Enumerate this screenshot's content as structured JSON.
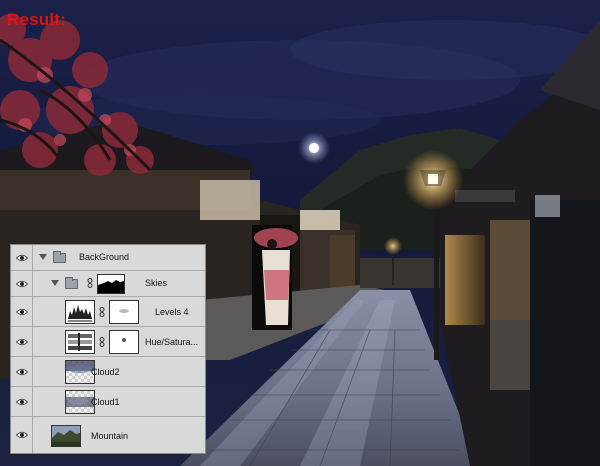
{
  "result_label": "Result:",
  "layers_panel": {
    "layers": [
      {
        "name": "BackGround",
        "type": "group"
      },
      {
        "name": "Skies",
        "type": "group"
      },
      {
        "name": "Levels 4",
        "type": "adjustment"
      },
      {
        "name": "Hue/Satura...",
        "type": "adjustment"
      },
      {
        "name": "Cloud2",
        "type": "image"
      },
      {
        "name": "Cloud1",
        "type": "image"
      },
      {
        "name": "Mountain",
        "type": "image"
      }
    ]
  },
  "colors": {
    "result_label": "#e01212",
    "panel_bg": "#d7d7d7",
    "night_sky": "#141a3a"
  },
  "icons": [
    "eye-icon",
    "folder-icon",
    "chain-link-icon",
    "disclosure-triangle-icon"
  ]
}
